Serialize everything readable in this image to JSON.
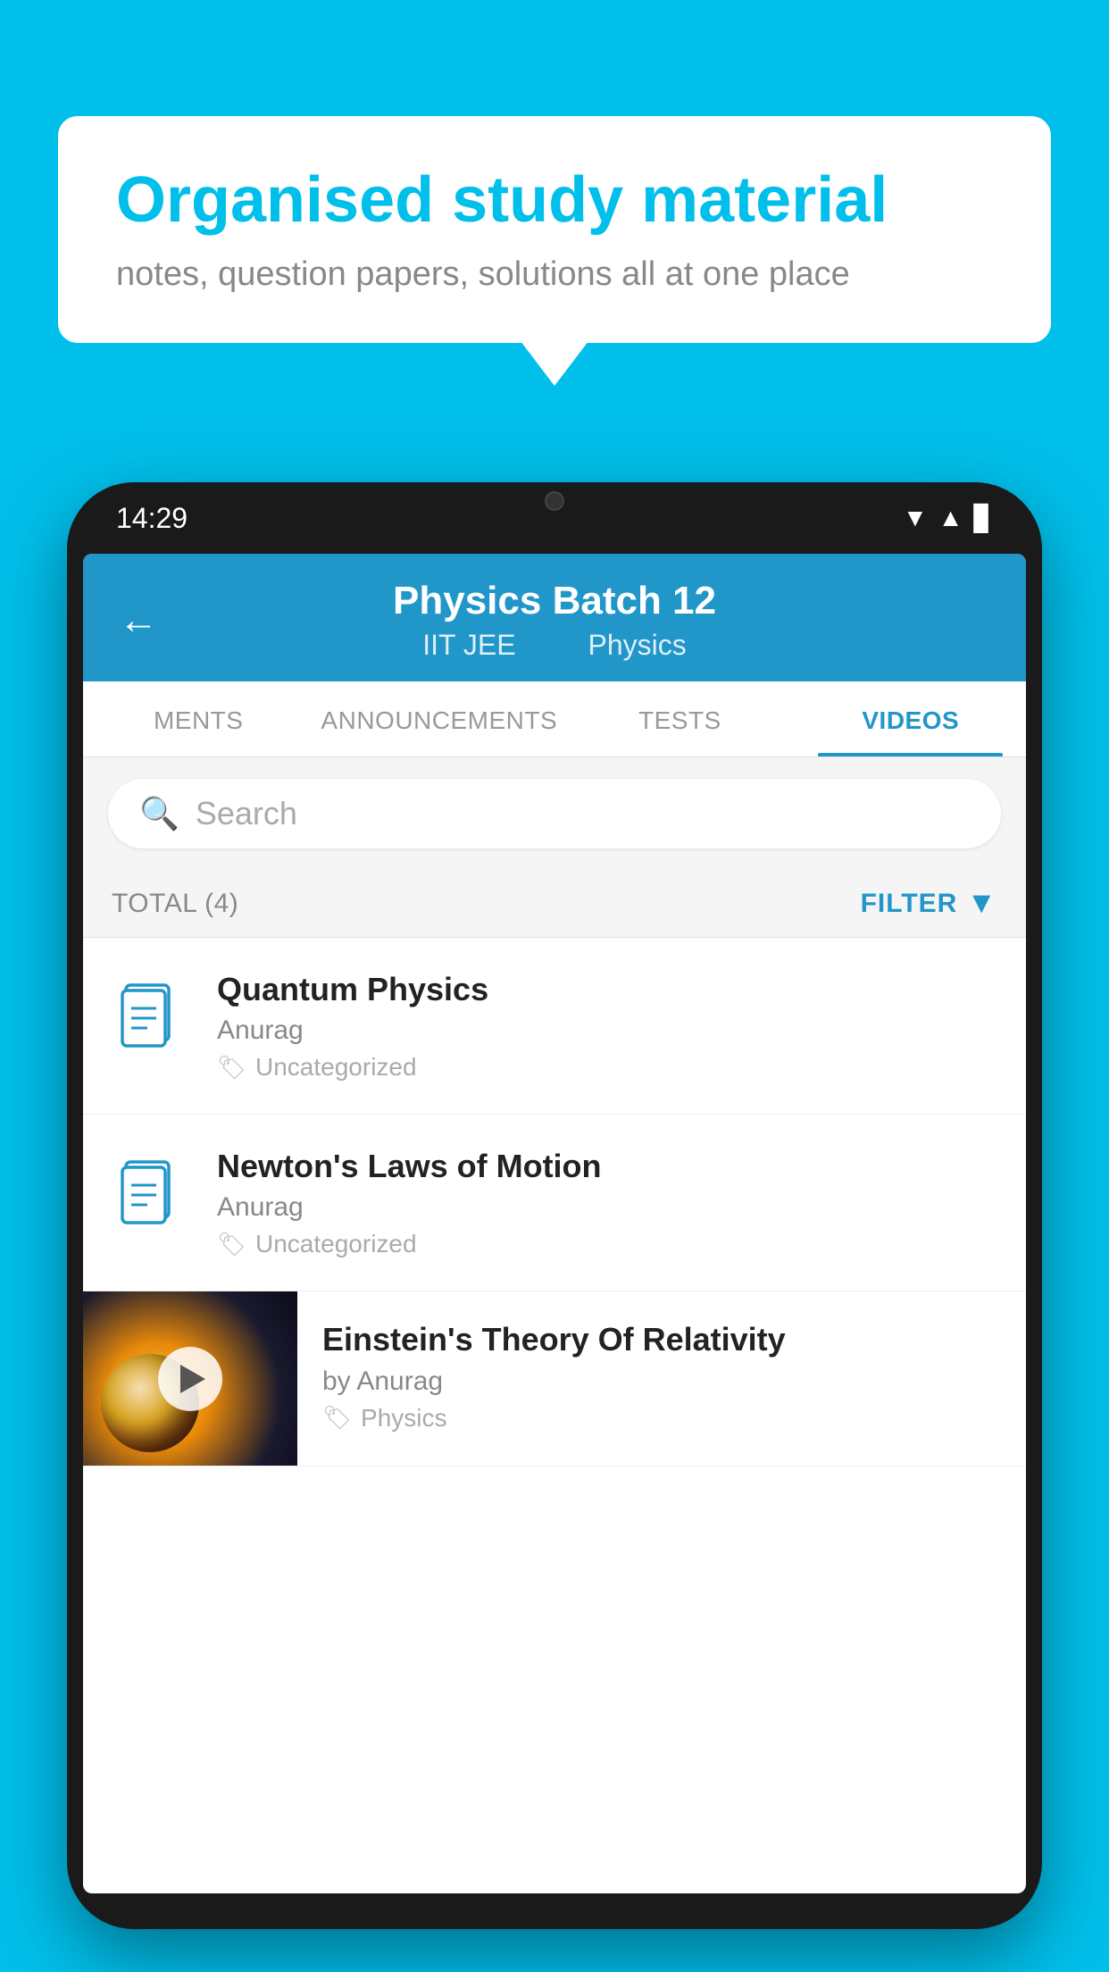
{
  "background_color": "#00BFEA",
  "speech_bubble": {
    "title": "Organised study material",
    "subtitle": "notes, question papers, solutions all at one place"
  },
  "phone": {
    "time": "14:29",
    "header": {
      "title": "Physics Batch 12",
      "subtitle_part1": "IIT JEE",
      "subtitle_part2": "Physics",
      "back_label": "←"
    },
    "tabs": [
      {
        "label": "MENTS",
        "active": false
      },
      {
        "label": "ANNOUNCEMENTS",
        "active": false
      },
      {
        "label": "TESTS",
        "active": false
      },
      {
        "label": "VIDEOS",
        "active": true
      }
    ],
    "search": {
      "placeholder": "Search"
    },
    "filter": {
      "total_label": "TOTAL (4)",
      "filter_label": "FILTER"
    },
    "videos": [
      {
        "title": "Quantum Physics",
        "author": "Anurag",
        "tag": "Uncategorized",
        "has_thumbnail": false
      },
      {
        "title": "Newton's Laws of Motion",
        "author": "Anurag",
        "tag": "Uncategorized",
        "has_thumbnail": false
      },
      {
        "title": "Einstein's Theory Of Relativity",
        "author": "by Anurag",
        "tag": "Physics",
        "has_thumbnail": true
      }
    ]
  }
}
